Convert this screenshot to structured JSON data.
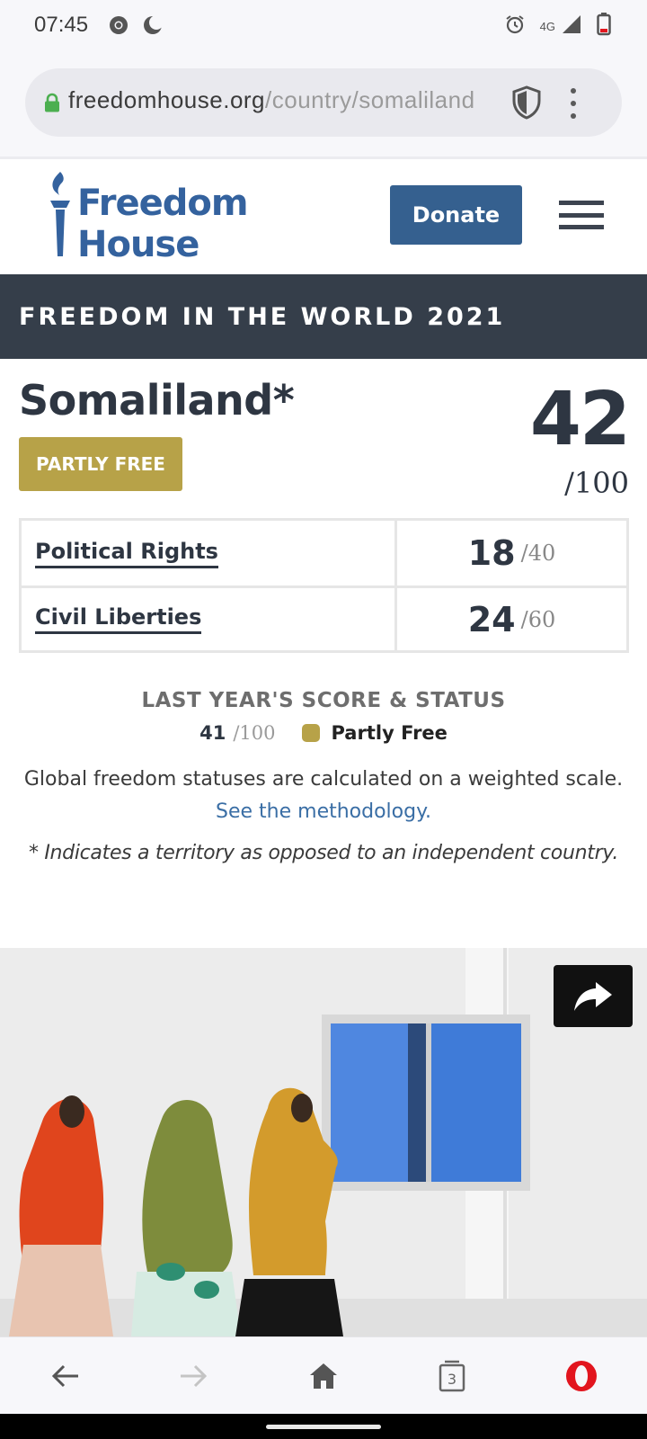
{
  "statusbar": {
    "time": "07:45",
    "network": "4G",
    "icons": [
      "chrome-icon",
      "moon-icon",
      "alarm-icon",
      "signal-icon",
      "battery-icon"
    ]
  },
  "browser": {
    "url_host": "freedomhouse.org",
    "url_path": "/country/somaliland",
    "tab_count": "3",
    "accent_color": "#e2151e"
  },
  "header": {
    "logo_line1": "Freedom",
    "logo_line2": "House",
    "donate_label": "Donate",
    "brand_color": "#34629e"
  },
  "banner": {
    "title": "FREEDOM IN THE WORLD 2021"
  },
  "country": {
    "name": "Somaliland*",
    "status": "PARTLY FREE",
    "status_color": "#b7a248",
    "total_score": "42",
    "total_max": "/100"
  },
  "scores": [
    {
      "label": "Political Rights",
      "score": "18",
      "max": "/40"
    },
    {
      "label": "Civil Liberties",
      "score": "24",
      "max": "/60"
    }
  ],
  "last_year": {
    "title": "LAST YEAR'S SCORE & STATUS",
    "score": "41",
    "max": "/100",
    "status": "Partly Free"
  },
  "notes": {
    "weighted": "Global freedom statuses are calculated on a weighted scale.",
    "methodology_link": "See the methodology.",
    "footnote": "* Indicates a territory as opposed to an independent country."
  }
}
